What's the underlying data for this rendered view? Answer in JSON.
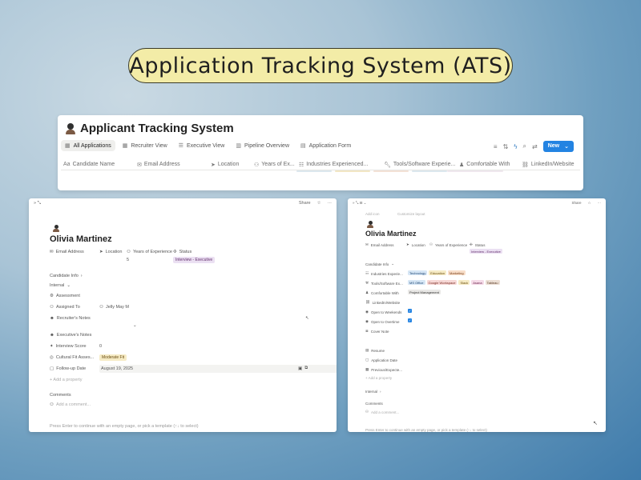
{
  "title": "Application Tracking System (ATS)",
  "db": {
    "title": "Applicant Tracking System",
    "tabs": [
      "All Applications",
      "Recruiter View",
      "Executive View",
      "Pipeline Overview",
      "Application Form"
    ],
    "new_label": "New",
    "columns": [
      "Candidate Name",
      "Email Address",
      "Location",
      "Years of Ex...",
      "Industries Experienced...",
      "Tools/Software Experie...",
      "Comfortable With",
      "LinkedIn/Website"
    ],
    "colors": {
      "accent": "#2383e2",
      "title_bg": "#f3eca7"
    }
  },
  "left": {
    "share": "Share",
    "name": "Olivia Martinez",
    "email_label": "Email Address",
    "location_label": "Location",
    "years_label": "Years of Experience",
    "status_label": "Status",
    "years_value": "5",
    "status_value": "Interview - Executive",
    "candidate_info": "Candidate Info",
    "internal": "Internal",
    "assessment": "Assessment",
    "assigned_label": "Assigned To",
    "assigned_value": "Jelly May M",
    "recruiter_notes": "Recruiter's Notes",
    "executive_notes": "Executive's Notes",
    "interview_score_label": "Interview Score",
    "interview_score_value": "0",
    "cultural_fit_label": "Cultural Fit Asses...",
    "cultural_fit_value": "Moderate Fit",
    "followup_label": "Follow-up Date",
    "followup_value": "August 19, 2025",
    "add_property": "+ Add a property",
    "comments": "Comments",
    "add_comment": "Add a comment...",
    "footer": "Press Enter to continue with an empty page, or pick a template (↑↓ to select)"
  },
  "right": {
    "share": "Share",
    "add_icon": "Add icon",
    "customize": "Customize layout",
    "name": "Olivia Martinez",
    "email_label": "Email Address",
    "location_label": "Location",
    "years_label": "Years of Experience",
    "status_label": "Status",
    "status_value": "Interview - Executive",
    "candidate_info": "Candidate Info",
    "industries_label": "Industries Experie...",
    "industries": [
      "Technology",
      "Education",
      "Marketing"
    ],
    "tools_label": "Tools/Software Ex...",
    "tools": [
      "MS Office",
      "Google Workspace",
      "Slack",
      "Asana",
      "Tableau"
    ],
    "comfortable_label": "Comfortable With",
    "comfortable_value": "Project Management",
    "linkedin_label": "LinkedIn/Website",
    "weekends_label": "Open to Weekends",
    "overtime_label": "Open to Overtime",
    "cover_label": "Cover Note",
    "resume_label": "Resume",
    "app_date_label": "Application Date",
    "prev_label": "Previous/Expecte...",
    "add_property": "+ Add a property",
    "internal": "Internal",
    "comments": "Comments",
    "add_comment": "Add a comment...",
    "footer": "Press Enter to continue with an empty page, or pick a template (↑↓ to select)"
  }
}
